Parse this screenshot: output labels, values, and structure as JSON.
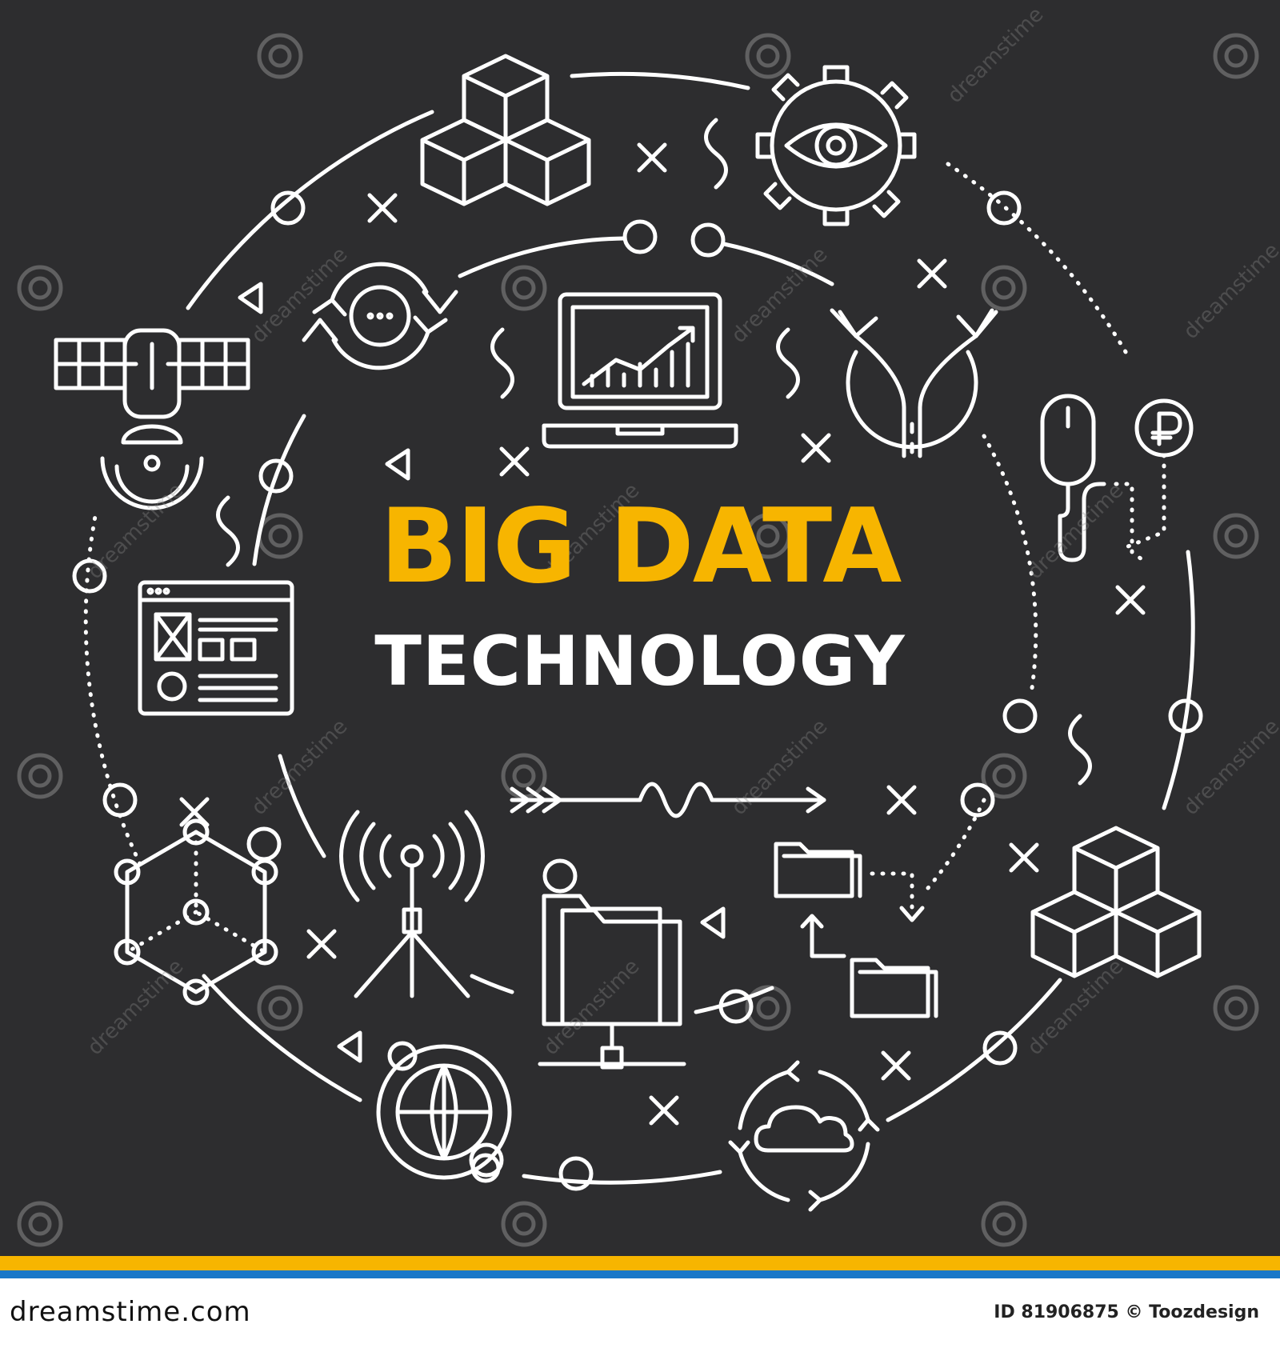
{
  "title": {
    "line1": "BIG DATA",
    "line2": "TECHNOLOGY"
  },
  "watermark": {
    "text": "dreamstime"
  },
  "footer": {
    "logo_text": "dreamstime.com",
    "image_credit": "ID 81906875 © Toozdesign"
  },
  "colors": {
    "background": "#2d2d2f",
    "accent_yellow": "#f7b500",
    "accent_blue": "#1a78c8",
    "line": "#ffffff"
  },
  "icons": [
    "cubes-icon",
    "gear-eye-icon",
    "satellite-icon",
    "refresh-chat-icon",
    "laptop-chart-icon",
    "split-road-arrows-icon",
    "mouse-icon",
    "ruble-coin-icon",
    "browser-window-icon",
    "network-cube-icon",
    "radio-tower-icon",
    "server-folder-icon",
    "folder-sync-icon",
    "globe-orbit-icon",
    "cloud-sync-icon",
    "cubes-right-icon"
  ]
}
